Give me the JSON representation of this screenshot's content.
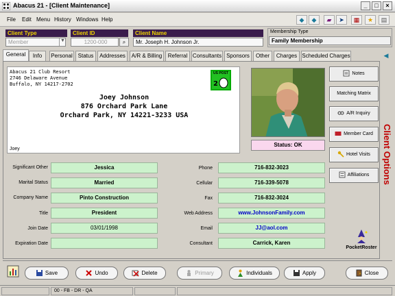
{
  "window": {
    "title": "Abacus 21 - [Client Maintenance]"
  },
  "menu": [
    "File",
    "Edit",
    "Menu",
    "History",
    "Windows",
    "Help"
  ],
  "header": {
    "client_type_label": "Client Type",
    "client_type_value": "Member",
    "client_id_label": "Client ID",
    "client_id_value": "1200-000",
    "client_name_label": "Client Name",
    "client_name_value": "Mr. Joseph H. Johnson Jr.",
    "membership_type_label": "Membership Type",
    "membership_type_value": "Family Membership"
  },
  "tabs": [
    "General",
    "Info",
    "Personal",
    "Status",
    "Addresses",
    "A/R & Billing",
    "Referral",
    "Consultants",
    "Sponsors",
    "Other",
    "Charges",
    "Scheduled Charges"
  ],
  "envelope": {
    "return_line1": "Abacus 21 Club  Resort",
    "return_line2": "2746 Delaware Avenue",
    "return_line3": "Buffalo, NY 14217-2702",
    "addr_line1": "Joey Johnson",
    "addr_line2": "876 Orchard Park Lane",
    "addr_line3": "Orchard Park, NY 14221-3233    USA",
    "nickname": "Joey",
    "stamp_text": "US POST"
  },
  "status_text": "Status: OK",
  "client_options_label": "Client Options",
  "side_buttons": [
    "Notes",
    "Matching Matrix",
    "A/R Inquiry",
    "Member Card",
    "Hotel Visits",
    "Affiliations"
  ],
  "fields_left": [
    {
      "label": "Significant Other",
      "value": "Jessica"
    },
    {
      "label": "Marital Status",
      "value": "Married"
    },
    {
      "label": "Company Name",
      "value": "Pinto Construction"
    },
    {
      "label": "Title",
      "value": "President"
    },
    {
      "label": "Join Date",
      "value": "03/01/1998"
    },
    {
      "label": "Expiration Date",
      "value": ""
    }
  ],
  "fields_right": [
    {
      "label": "Phone",
      "value": "716-832-3023"
    },
    {
      "label": "Cellular",
      "value": "716-339-5078"
    },
    {
      "label": "Fax",
      "value": "716-832-3024"
    },
    {
      "label": "Web Address",
      "value": "www.JohnsonFamily.com"
    },
    {
      "label": "Email",
      "value": "JJ@aol.com"
    },
    {
      "label": "Consultant",
      "value": "Carrick, Karen"
    }
  ],
  "pocket_roster": "PocketRoster",
  "bottom_buttons": [
    "Save",
    "Undo",
    "Delete",
    "Primary",
    "Individuals",
    "Apply",
    "Close"
  ],
  "statusbar": {
    "text": "00 - FB - DR - QA"
  },
  "colors": {
    "header_bg": "#3a1c4c",
    "header_fg": "#f0d400",
    "field_green": "#ccf2cc",
    "status_pink": "#fad7ee",
    "options_red": "#c00000"
  }
}
